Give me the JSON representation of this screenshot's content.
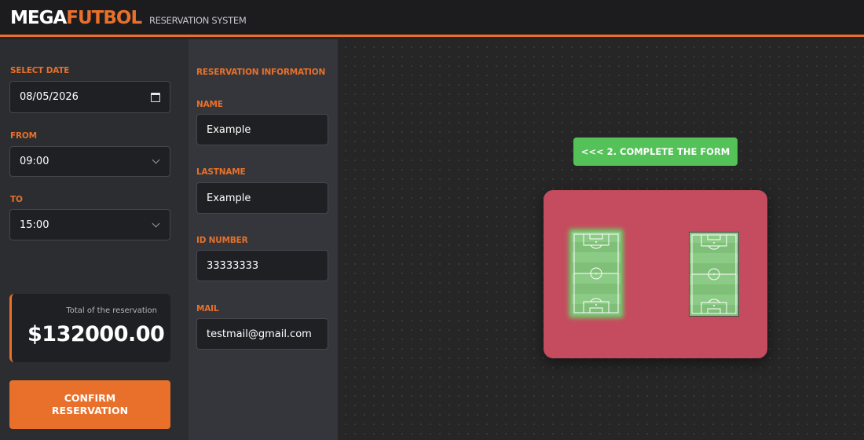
{
  "header": {
    "logo_part1": "MEGA",
    "logo_part2": "FUTBOL",
    "subtitle": "RESERVATION SYSTEM"
  },
  "booking": {
    "date_label": "SELECT DATE",
    "date_value": "08/05/2026",
    "from_label": "FROM",
    "from_value": "09:00",
    "to_label": "TO",
    "to_value": "15:00"
  },
  "total": {
    "label": "Total of the reservation",
    "value": "$132000.00"
  },
  "confirm_label": "CONFIRM RESERVATION",
  "form": {
    "heading": "RESERVATION INFORMATION",
    "name_label": "NAME",
    "name_value": "Example",
    "lastname_label": "LASTNAME",
    "lastname_value": "Example",
    "id_label": "ID NUMBER",
    "id_value": "33333333",
    "mail_label": "MAIL",
    "mail_value": "testmail@gmail.com"
  },
  "step_hint": "<<< 2. COMPLETE THE FORM",
  "fields": [
    {
      "state": "selected"
    },
    {
      "state": "available"
    }
  ],
  "colors": {
    "accent": "#e8702a",
    "venue_bg": "#c54b5e",
    "hint_green": "#55c159",
    "pitch_green": "#7fbf78",
    "selected_glow": "#5ee36b"
  }
}
